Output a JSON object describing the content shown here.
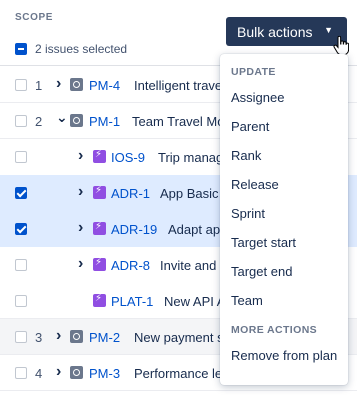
{
  "header": {
    "scope_label": "SCOPE",
    "selection_text": "2 issues selected",
    "bulk_button_label": "Bulk actions"
  },
  "rows": [
    {
      "num": "1",
      "expanded": false,
      "type": "epic",
      "key": "PM-4",
      "title": "Intelligent trave",
      "checked": false,
      "bg": "white"
    },
    {
      "num": "2",
      "expanded": true,
      "type": "epic",
      "key": "PM-1",
      "title": "Team Travel Mo",
      "checked": false,
      "bg": "white"
    },
    {
      "num": "",
      "expanded": false,
      "type": "story",
      "key": "IOS-9",
      "title": "Trip manag",
      "checked": false,
      "bg": "white"
    },
    {
      "num": "",
      "expanded": false,
      "type": "story",
      "key": "ADR-1",
      "title": "App Basic",
      "checked": true,
      "bg": "selected"
    },
    {
      "num": "",
      "expanded": false,
      "type": "story",
      "key": "ADR-19",
      "title": "Adapt ap",
      "checked": true,
      "bg": "selected"
    },
    {
      "num": "",
      "expanded": false,
      "type": "story",
      "key": "ADR-8",
      "title": "Invite and",
      "checked": false,
      "bg": "white"
    },
    {
      "num": "",
      "expanded": false,
      "type": "story",
      "key": "PLAT-1",
      "title": "New API A",
      "checked": false,
      "bg": "white"
    },
    {
      "num": "3",
      "expanded": false,
      "type": "epic",
      "key": "PM-2",
      "title": "New payment s",
      "checked": false,
      "bg": "gray"
    },
    {
      "num": "4",
      "expanded": false,
      "type": "epic",
      "key": "PM-3",
      "title": "Performance le",
      "checked": false,
      "bg": "white"
    }
  ],
  "menu": {
    "update_header": "UPDATE",
    "update_items": [
      "Assignee",
      "Parent",
      "Rank",
      "Release",
      "Sprint",
      "Target start",
      "Target end",
      "Team"
    ],
    "more_header": "MORE ACTIONS",
    "more_items": [
      "Remove from plan"
    ]
  },
  "colors": {
    "accent": "#0052CC",
    "button_bg": "#253858",
    "story_icon": "#904EE2",
    "epic_icon": "#6B778C",
    "selected_row": "#DEEBFF"
  }
}
